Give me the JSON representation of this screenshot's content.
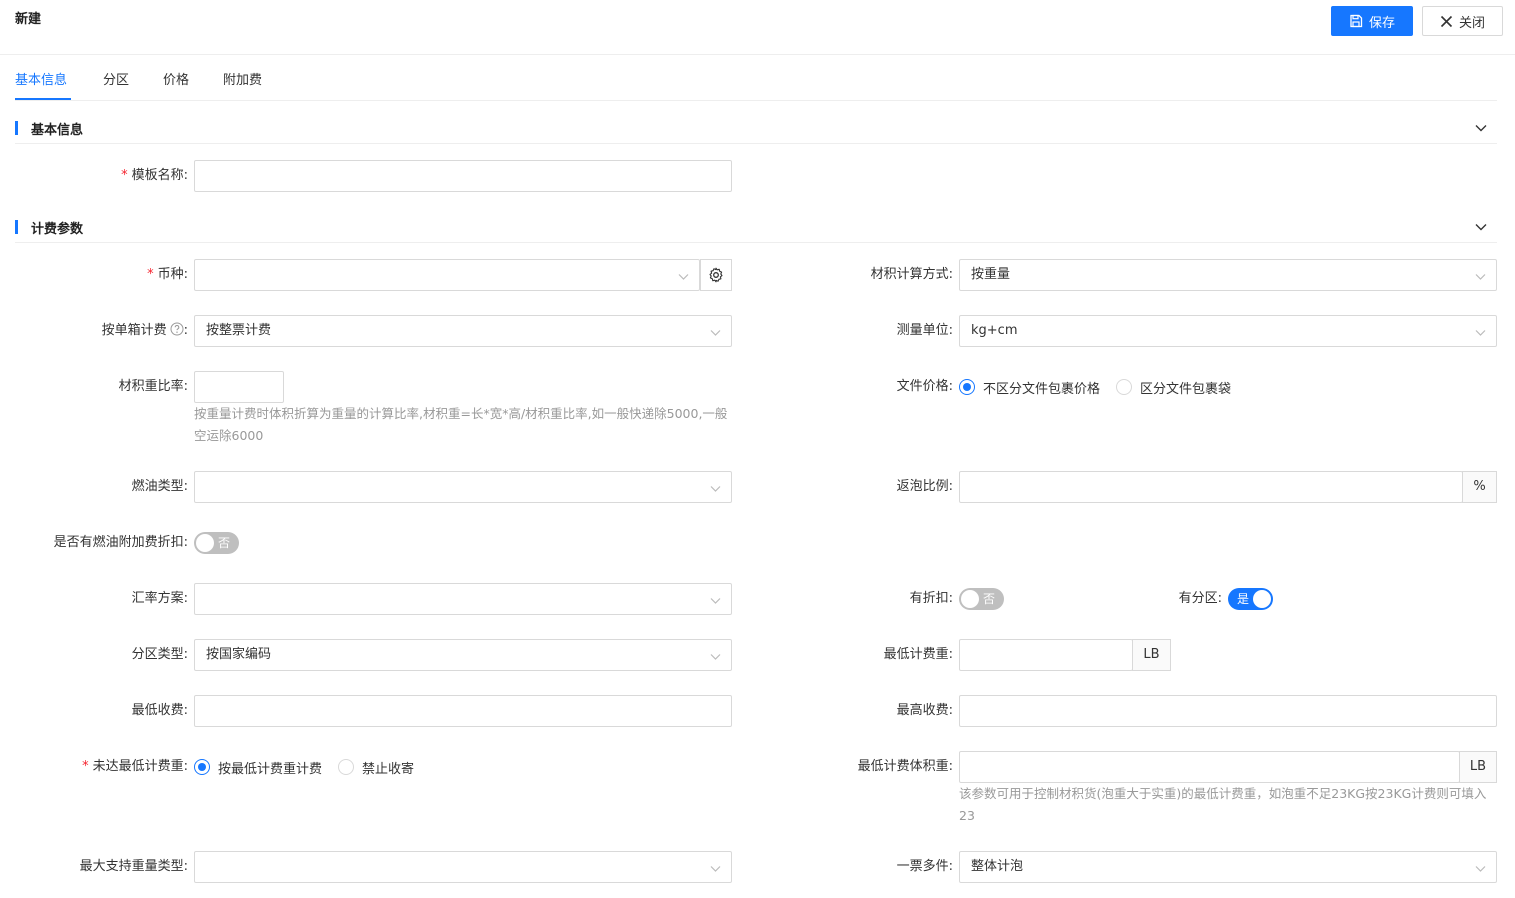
{
  "header": {
    "title": "新建",
    "save_label": "保存",
    "close_label": "关闭"
  },
  "tabs": [
    {
      "label": "基本信息",
      "active": true
    },
    {
      "label": "分区"
    },
    {
      "label": "价格"
    },
    {
      "label": "附加费"
    }
  ],
  "sections": {
    "basic": {
      "title": "基本信息"
    },
    "billing": {
      "title": "计费参数"
    }
  },
  "form": {
    "template_name": {
      "label": "模板名称:",
      "value": ""
    },
    "currency": {
      "label": "币种:",
      "value": ""
    },
    "volume_calc": {
      "label": "材积计算方式:",
      "value": "按重量"
    },
    "per_box": {
      "label": "按单箱计费",
      "colon": ":",
      "value": "按整票计费"
    },
    "unit": {
      "label": "测量单位:",
      "value": "kg+cm"
    },
    "vol_ratio": {
      "label": "材积重比率:",
      "value": "",
      "hint": "按重量计费时体积折算为重量的计算比率,材积重=长*宽*高/材积重比率,如一般快递除5000,一般空运除6000"
    },
    "doc_price": {
      "label": "文件价格:",
      "options": [
        "不区分文件包裹价格",
        "区分文件包裹袋"
      ],
      "selected": 0
    },
    "fuel_type": {
      "label": "燃油类型:",
      "value": ""
    },
    "bubble_ratio": {
      "label": "返泡比例:",
      "value": "",
      "suffix": "%"
    },
    "fuel_discount": {
      "label": "是否有燃油附加费折扣:",
      "state": "否"
    },
    "rate_plan": {
      "label": "汇率方案:",
      "value": ""
    },
    "has_discount": {
      "label": "有折扣:",
      "state": "否"
    },
    "has_zone": {
      "label": "有分区:",
      "state": "是"
    },
    "zone_type": {
      "label": "分区类型:",
      "value": "按国家编码"
    },
    "min_weight": {
      "label": "最低计费重:",
      "value": "",
      "suffix": "LB"
    },
    "min_fee": {
      "label": "最低收费:",
      "value": ""
    },
    "max_fee": {
      "label": "最高收费:",
      "value": ""
    },
    "below_min": {
      "label": "未达最低计费重:",
      "options": [
        "按最低计费重计费",
        "禁止收寄"
      ],
      "selected": 0
    },
    "min_vol_weight": {
      "label": "最低计费体积重:",
      "value": "",
      "suffix": "LB",
      "hint": "该参数可用于控制材积货(泡重大于实重)的最低计费重，如泡重不足23KG按23KG计费则可填入23"
    },
    "max_weight_type": {
      "label": "最大支持重量类型:",
      "value": ""
    },
    "multi_piece": {
      "label": "一票多件:",
      "value": "整体计泡"
    }
  }
}
